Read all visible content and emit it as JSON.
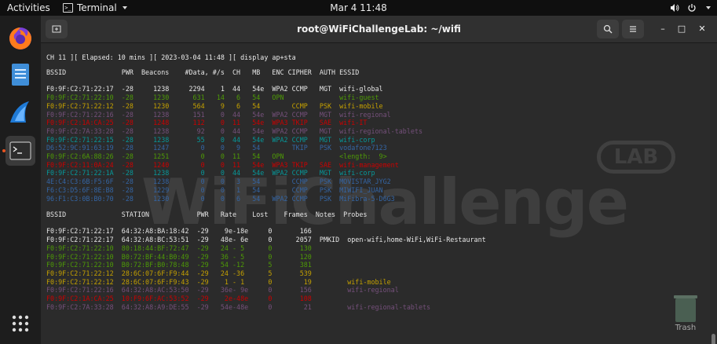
{
  "topbar": {
    "activities": "Activities",
    "app_menu": "Terminal",
    "clock": "Mar 4  11:48",
    "icons": [
      "volume-icon",
      "power-icon"
    ]
  },
  "dock": {
    "apps": [
      "firefox-icon",
      "files-icon",
      "wireshark-icon",
      "terminal-icon"
    ],
    "show_apps": "show-apps-icon"
  },
  "window": {
    "title": "root@WiFiChallengeLab: ~/wifi"
  },
  "watermark": {
    "logo": "WiFiChallenge",
    "badge": "LAB"
  },
  "desktop": {
    "trash_label": "Trash"
  },
  "terminal": {
    "status_line": "CH 11 ][ Elapsed: 10 mins ][ 2023-03-04 11:48 ][ display ap+sta",
    "ap_header": "BSSID              PWR  Beacons    #Data, #/s  CH   MB   ENC CIPHER  AUTH ESSID",
    "ap_rows": [
      {
        "text": "F0:9F:C2:71:22:17  -28     1238     2294    1  44   54e  WPA2 CCMP   MGT  wifi-global",
        "color": "w"
      },
      {
        "text": "F0:9F:C2:71:22:10  -28     1230      631   14   6   54   OPN              wifi-guest",
        "color": "g"
      },
      {
        "text": "F0:9F:C2:71:22:12  -28     1230      564    9   6   54        CCMP   PSK  wifi-mobile",
        "color": "y"
      },
      {
        "text": "F0:9F:C2:71:22:16  -28     1238      151    0  44   54e  WPA2 CCMP   MGT  wifi-regional",
        "color": "m"
      },
      {
        "text": "F0:9F:C2:1A:CA:25  -28     1248      112    0  11   54e  WPA3 TKIP   SAE  wifi-IT",
        "color": "r"
      },
      {
        "text": "F0:9F:C2:7A:33:28  -28     1238       92    0  44   54e  WPA2 CCMP   MGT  wifi-regional-tablets",
        "color": "m"
      },
      {
        "text": "F0:9F:C2:71:22:15  -28     1238       55    0  44   54e  WPA2 CCMP   MGT  wifi-corp",
        "color": "c"
      },
      {
        "text": "D6:52:9C:91:63:19  -28     1247        0    0   9   54        TKIP   PSK  vodafone7123",
        "color": "b"
      },
      {
        "text": "F0:9F:C2:6A:88:26  -28     1251        0    0  11   54   OPN              <length:  9>",
        "color": "g"
      },
      {
        "text": "F0:9F:C2:11:0A:24  -28     1240        0    0  11   54e  WPA3 TKIP   SAE  wifi-management",
        "color": "r"
      },
      {
        "text": "F0:9F:C2:71:22:1A  -28     1238        0    0  44   54e  WPA2 CCMP   MGT  wifi-corp",
        "color": "c"
      },
      {
        "text": "4E:C4:C3:6B:F5:6F  -28     1238        0    0   3   54        CCMP   PSK  MOVISTAR_JYG2",
        "color": "b"
      },
      {
        "text": "F6:C3:D5:6F:8E:B8  -28     1229        0    0   1   54        CCMP   PSK  MIWIFI_JUAN",
        "color": "b"
      },
      {
        "text": "96:F1:C3:0B:B0:70  -28     1230        0    0   6   54   WPA2 CCMP   PSK  MiFibra-5-D6G3",
        "color": "b"
      }
    ],
    "sta_header": "BSSID              STATION            PWR   Rate    Lost    Frames  Notes  Probes",
    "sta_rows": [
      {
        "text": "F0:9F:C2:71:22:17  64:32:A8:BA:18:42  -29    9e-18e     0       166",
        "color": "w"
      },
      {
        "text": "F0:9F:C2:71:22:17  64:32:A8:BC:53:51  -29   48e- 6e     0      2057  PMKID  open-wifi,home-WiFi,WiFi-Restaurant",
        "color": "w"
      },
      {
        "text": "F0:9F:C2:71:22:10  80:18:44:BF:72:47  -29   24 - 5      0       130",
        "color": "g"
      },
      {
        "text": "F0:9F:C2:71:22:10  B0:72:BF:44:B0:49  -29   36 - 5      0       120",
        "color": "g"
      },
      {
        "text": "F0:9F:C2:71:22:10  B0:72:BF:B0:78:48  -29   54 -12      5       381",
        "color": "g"
      },
      {
        "text": "F0:9F:C2:71:22:12  28:6C:07:6F:F9:44  -29   24 -36      5       539",
        "color": "y"
      },
      {
        "text": "F0:9F:C2:71:22:12  28:6C:07:6F:F9:43  -29    1 - 1      0        19         wifi-mobile",
        "color": "y"
      },
      {
        "text": "F0:9F:C2:71:22:16  64:32:A8:AC:53:50  -29   36e- 9e     0       156         wifi-regional",
        "color": "m"
      },
      {
        "text": "F0:9F:C2:1A:CA:25  10:F9:6F:AC:53:52  -29    2e-48e     0       108",
        "color": "r"
      },
      {
        "text": "F0:9F:C2:7A:33:28  64:32:A8:A9:DE:55  -29   54e-48e     0        21         wifi-regional-tablets",
        "color": "m"
      }
    ]
  }
}
